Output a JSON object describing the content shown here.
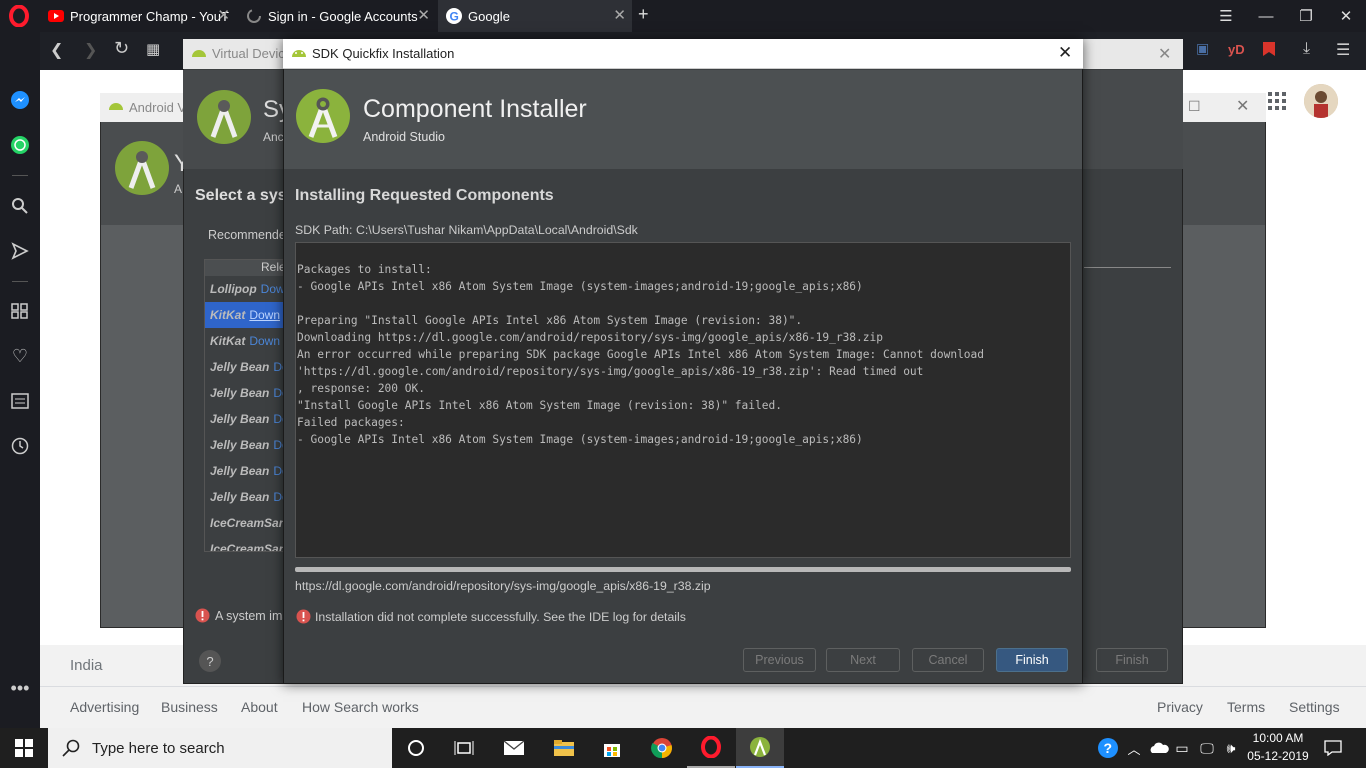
{
  "browser": {
    "tabs": [
      {
        "label": "Programmer Champ - YouT",
        "icon": "youtube-icon"
      },
      {
        "label": "Sign in - Google Accounts",
        "icon": "loading-icon"
      },
      {
        "label": "Google",
        "icon": "google-icon"
      }
    ],
    "addressbar_badge": "yD"
  },
  "google_page": {
    "country": "India",
    "footer_left": [
      "Advertising",
      "Business",
      "About",
      "How Search works"
    ],
    "footer_right": [
      "Privacy",
      "Terms",
      "Settings"
    ]
  },
  "avd_window": {
    "title": "Android V",
    "heading_partial": "Y",
    "sub_partial": "A"
  },
  "vdc_window": {
    "title": "Virtual Device",
    "heading_partial": "Sy",
    "sub_partial": "Anc",
    "select_label": "Select a syst",
    "tab_recommended": "Recommende",
    "column_release": "Rele",
    "rows": [
      {
        "name": "Lollipop",
        "link": "Dow"
      },
      {
        "name": "KitKat",
        "link": "Down"
      },
      {
        "name": "KitKat",
        "link": "Down"
      },
      {
        "name": "Jelly Bean",
        "link": "Do"
      },
      {
        "name": "Jelly Bean",
        "link": "Do"
      },
      {
        "name": "Jelly Bean",
        "link": "Do"
      },
      {
        "name": "Jelly Bean",
        "link": "Do"
      },
      {
        "name": "Jelly Bean",
        "link": "Do"
      },
      {
        "name": "Jelly Bean",
        "link": "Do"
      },
      {
        "name": "IceCreamSan",
        "link": ""
      },
      {
        "name": "IceCreamSan",
        "link": ""
      }
    ],
    "warning": "A system ima",
    "finish": "Finish"
  },
  "dialog": {
    "title": "SDK Quickfix Installation",
    "header_title": "Component Installer",
    "header_sub": "Android Studio",
    "section_title": "Installing Requested Components",
    "sdk_path_label": "SDK Path:",
    "sdk_path_value": "C:\\Users\\Tushar Nikam\\AppData\\Local\\Android\\Sdk",
    "log": "Packages to install:\n- Google APIs Intel x86 Atom System Image (system-images;android-19;google_apis;x86)\n\nPreparing \"Install Google APIs Intel x86 Atom System Image (revision: 38)\".\nDownloading https://dl.google.com/android/repository/sys-img/google_apis/x86-19_r38.zip\nAn error occurred while preparing SDK package Google APIs Intel x86 Atom System Image: Cannot download\n'https://dl.google.com/android/repository/sys-img/google_apis/x86-19_r38.zip': Read timed out\n, response: 200 OK.\n\"Install Google APIs Intel x86 Atom System Image (revision: 38)\" failed.\nFailed packages:\n- Google APIs Intel x86 Atom System Image (system-images;android-19;google_apis;x86)",
    "progress_url": "https://dl.google.com/android/repository/sys-img/google_apis/x86-19_r38.zip",
    "progress": 1.0,
    "error_message": "Installation did not complete successfully. See the IDE log for details",
    "buttons": {
      "previous": "Previous",
      "next": "Next",
      "cancel": "Cancel",
      "finish": "Finish"
    }
  },
  "taskbar": {
    "search_placeholder": "Type here to search",
    "time": "10:00 AM",
    "date": "05-12-2019"
  },
  "colors": {
    "accent_blue": "#365880",
    "android_green": "#a4c639",
    "error_red": "#d9534f"
  }
}
